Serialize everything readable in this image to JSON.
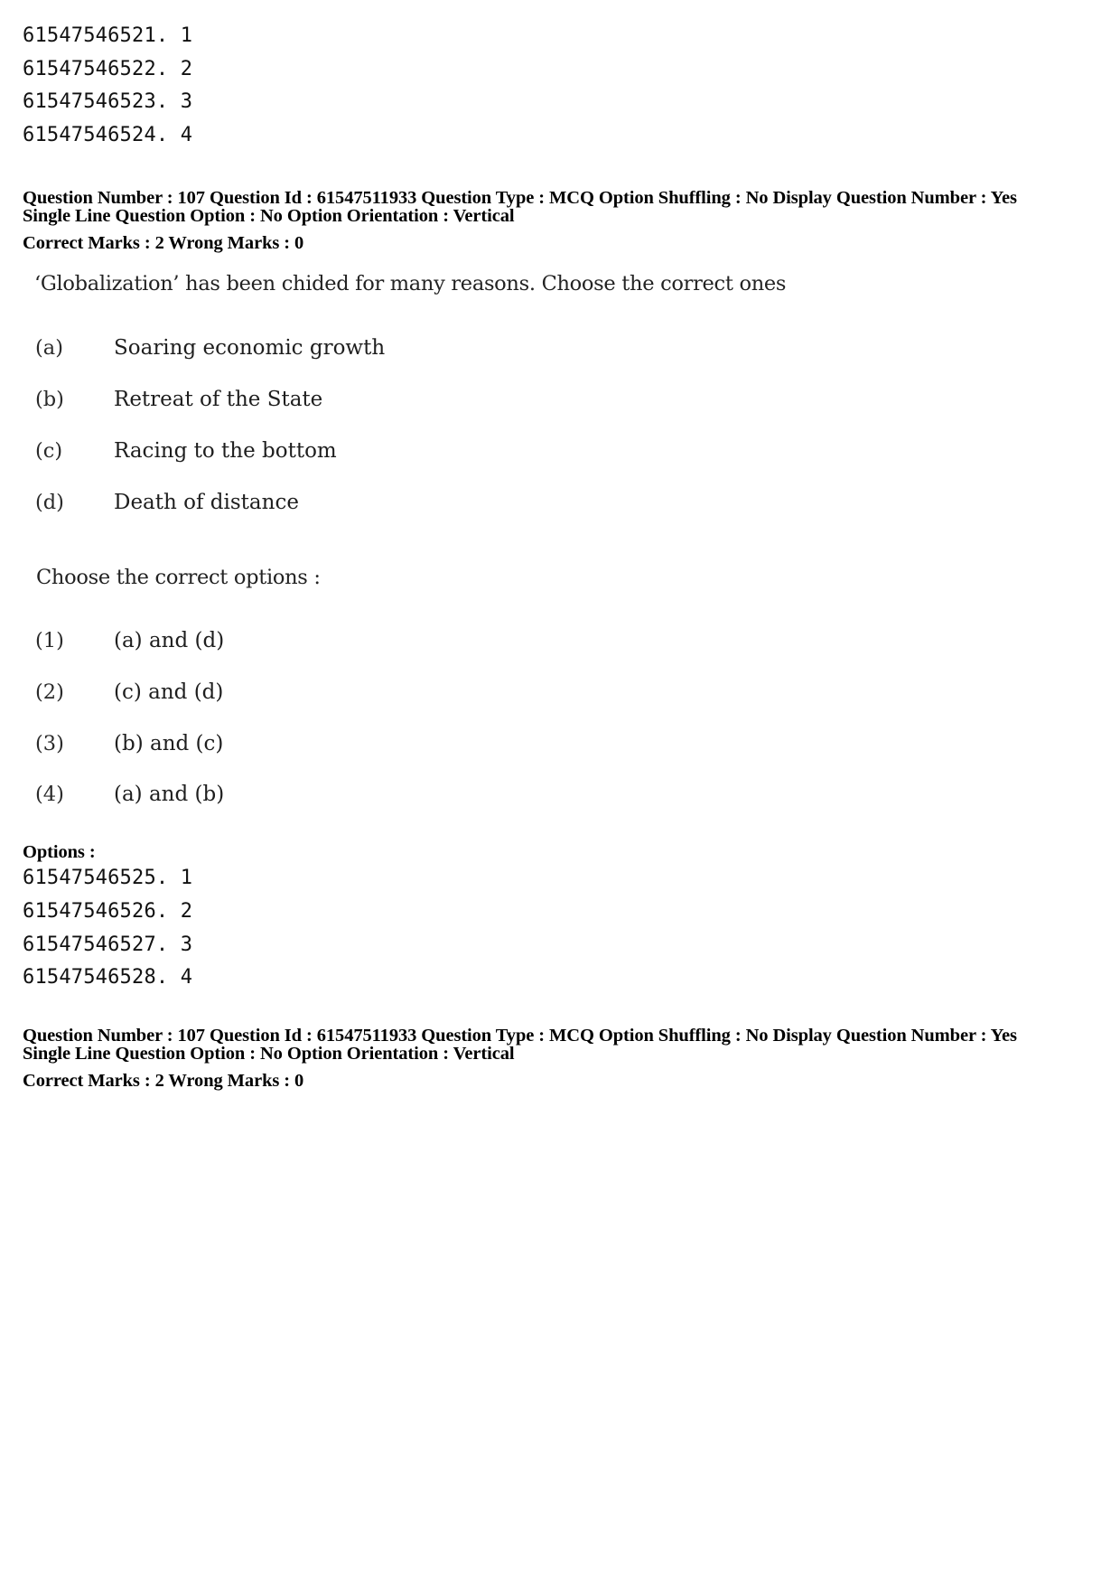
{
  "prev_options": [
    {
      "id": "61547546521",
      "num": "1"
    },
    {
      "id": "61547546522",
      "num": "2"
    },
    {
      "id": "61547546523",
      "num": "3"
    },
    {
      "id": "61547546524",
      "num": "4"
    }
  ],
  "question": {
    "meta_line1": "Question Number : 107  Question Id : 61547511933  Question Type : MCQ  Option Shuffling : No  Display Question Number : Yes",
    "meta_line2": "Single Line Question Option : No  Option Orientation : Vertical",
    "marks_line": "Correct Marks : 2  Wrong Marks : 0",
    "stem": "‘Globalization’ has been chided for many reasons. Choose the correct ones",
    "statements": [
      {
        "label": "(a)",
        "text": "Soaring economic growth"
      },
      {
        "label": "(b)",
        "text": "Retreat of the State"
      },
      {
        "label": "(c)",
        "text": "Racing to the bottom"
      },
      {
        "label": "(d)",
        "text": "Death of distance"
      }
    ],
    "choose_prompt": "Choose the correct options :",
    "choices": [
      {
        "label": "(1)",
        "text": "(a) and (d)"
      },
      {
        "label": "(2)",
        "text": "(c) and (d)"
      },
      {
        "label": "(3)",
        "text": "(b) and (c)"
      },
      {
        "label": "(4)",
        "text": "(a) and (b)"
      }
    ],
    "options_label": "Options :",
    "options": [
      {
        "id": "61547546525",
        "num": "1"
      },
      {
        "id": "61547546526",
        "num": "2"
      },
      {
        "id": "61547546527",
        "num": "3"
      },
      {
        "id": "61547546528",
        "num": "4"
      }
    ]
  },
  "next_question": {
    "meta_line1": "Question Number : 107  Question Id : 61547511933  Question Type : MCQ  Option Shuffling : No  Display Question Number : Yes",
    "meta_line2": "Single Line Question Option : No  Option Orientation : Vertical",
    "marks_line": "Correct Marks : 2  Wrong Marks : 0"
  }
}
